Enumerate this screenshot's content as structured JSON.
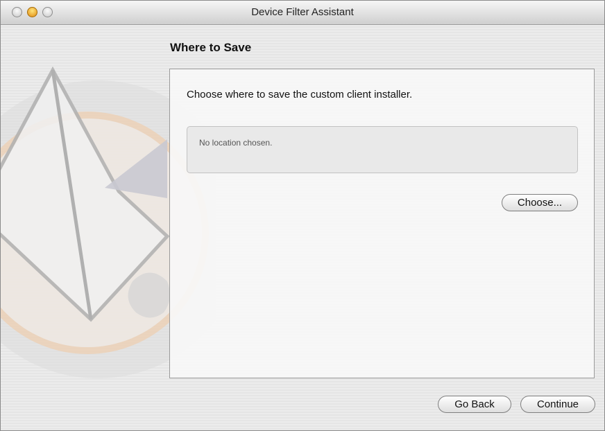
{
  "window": {
    "title": "Device Filter Assistant",
    "controls": [
      "close-button",
      "minimize-button",
      "zoom-button"
    ]
  },
  "step": {
    "heading": "Where to Save",
    "instruction": "Choose where to save the custom client installer.",
    "location_value": "No location chosen.",
    "choose_label": "Choose..."
  },
  "footer": {
    "back_label": "Go Back",
    "continue_label": "Continue"
  },
  "colors": {
    "minimize": "#f0a81e",
    "logo_accent": "#f2c9a0"
  }
}
